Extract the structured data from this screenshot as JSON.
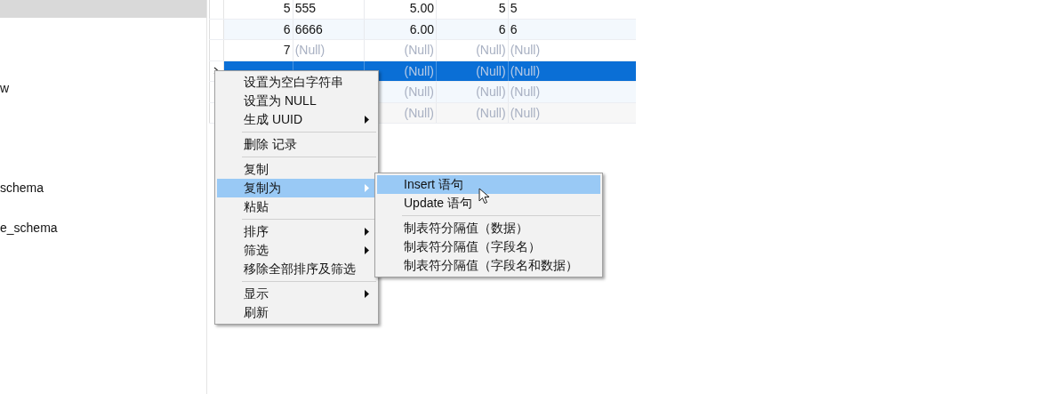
{
  "sidebar": {
    "items": [
      {
        "selected": true
      },
      {
        "label": "w",
        "selected": false
      },
      {
        "label": "schema",
        "selected": false
      },
      {
        "label": "e_schema",
        "selected": false
      }
    ]
  },
  "table": {
    "rows": [
      {
        "current": false,
        "selected": false,
        "cells": [
          {
            "text": "5",
            "kind": "value"
          },
          {
            "text": "555",
            "kind": "value"
          },
          {
            "text": "5.00",
            "kind": "value"
          },
          {
            "text": "5",
            "kind": "value"
          },
          {
            "text": "5",
            "kind": "value"
          }
        ]
      },
      {
        "current": false,
        "selected": false,
        "cells": [
          {
            "text": "6",
            "kind": "value"
          },
          {
            "text": "6666",
            "kind": "value"
          },
          {
            "text": "6.00",
            "kind": "value"
          },
          {
            "text": "6",
            "kind": "value"
          },
          {
            "text": "6",
            "kind": "value"
          }
        ]
      },
      {
        "current": false,
        "selected": false,
        "cells": [
          {
            "text": "7",
            "kind": "value"
          },
          {
            "text": "(Null)",
            "kind": "null"
          },
          {
            "text": "(Null)",
            "kind": "null"
          },
          {
            "text": "(Null)",
            "kind": "null"
          },
          {
            "text": "(Null)",
            "kind": "null"
          }
        ]
      },
      {
        "current": true,
        "selected": true,
        "cells": [
          {
            "kind": "hidden"
          },
          {
            "kind": "hidden"
          },
          {
            "text": "(Null)",
            "kind": "null"
          },
          {
            "text": "(Null)",
            "kind": "null"
          },
          {
            "text": "(Null)",
            "kind": "null"
          }
        ]
      },
      {
        "current": false,
        "selected": false,
        "cells": [
          {
            "kind": "hidden"
          },
          {
            "kind": "hidden"
          },
          {
            "text": "(Null)",
            "kind": "null"
          },
          {
            "text": "(Null)",
            "kind": "null"
          },
          {
            "text": "(Null)",
            "kind": "null"
          }
        ]
      },
      {
        "current": false,
        "selected": false,
        "cells": [
          {
            "kind": "hidden"
          },
          {
            "kind": "hidden"
          },
          {
            "text": "(Null)",
            "kind": "null"
          },
          {
            "text": "(Null)",
            "kind": "null"
          },
          {
            "text": "(Null)",
            "kind": "null"
          }
        ]
      }
    ]
  },
  "context_menu": {
    "groups": [
      [
        {
          "label": "设置为空白字符串",
          "submenu": false,
          "selected": false
        },
        {
          "label": "设置为 NULL",
          "submenu": false,
          "selected": false
        },
        {
          "label": "生成 UUID",
          "submenu": true,
          "selected": false
        }
      ],
      [
        {
          "label": "删除 记录",
          "submenu": false,
          "selected": false
        }
      ],
      [
        {
          "label": "复制",
          "submenu": false,
          "selected": false
        },
        {
          "label": "复制为",
          "submenu": true,
          "selected": true
        },
        {
          "label": "粘贴",
          "submenu": false,
          "selected": false
        }
      ],
      [
        {
          "label": "排序",
          "submenu": true,
          "selected": false
        },
        {
          "label": "筛选",
          "submenu": true,
          "selected": false
        },
        {
          "label": "移除全部排序及筛选",
          "submenu": false,
          "selected": false
        }
      ],
      [
        {
          "label": "显示",
          "submenu": true,
          "selected": false
        },
        {
          "label": "刷新",
          "submenu": false,
          "selected": false
        }
      ]
    ]
  },
  "submenu": {
    "groups": [
      [
        {
          "label": "Insert 语句",
          "selected": true
        },
        {
          "label": "Update 语句",
          "selected": false
        }
      ],
      [
        {
          "label": "制表符分隔值（数据）",
          "selected": false
        },
        {
          "label": "制表符分隔值（字段名）",
          "selected": false
        },
        {
          "label": "制表符分隔值（字段名和数据）",
          "selected": false
        }
      ]
    ]
  }
}
